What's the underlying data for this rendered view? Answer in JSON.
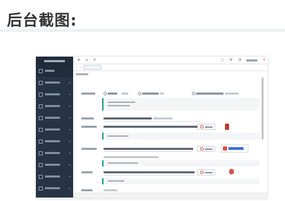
{
  "header": {
    "title": "后台截图:"
  },
  "screenshot": {
    "sidebar": {
      "item_count": 10,
      "active_index": 0
    },
    "colors": {
      "sidebar_bg": "#263445",
      "accent": "#1e9e8f",
      "danger": "#d9534f"
    }
  }
}
